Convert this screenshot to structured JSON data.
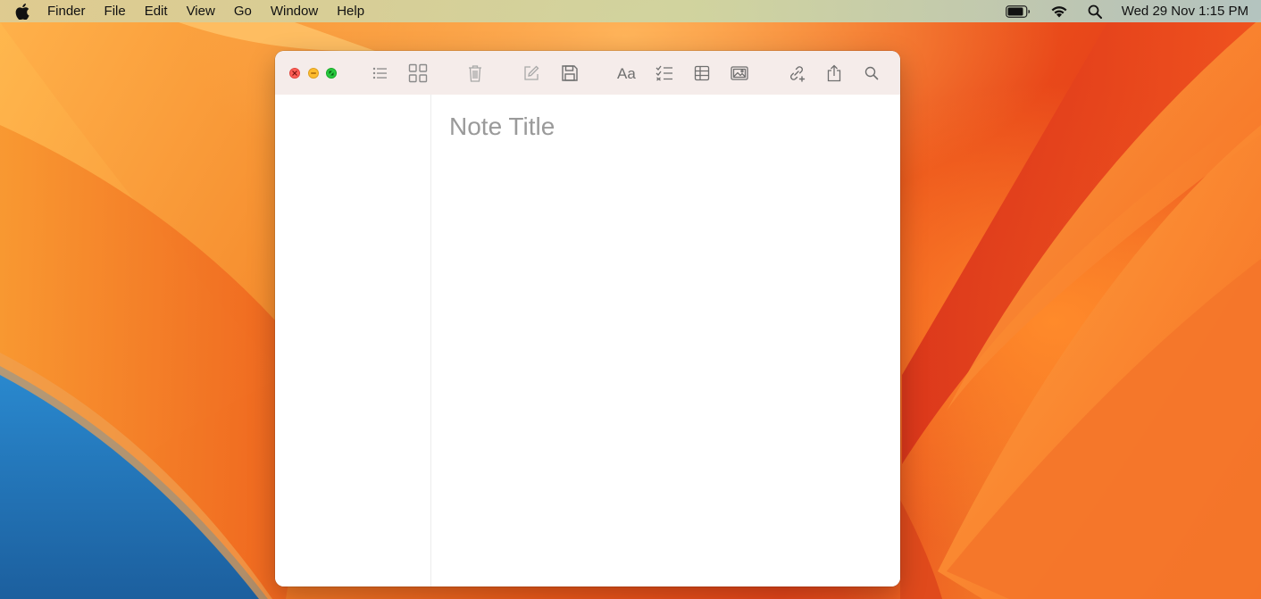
{
  "menubar": {
    "app_name": "Finder",
    "items": [
      "File",
      "Edit",
      "View",
      "Go",
      "Window",
      "Help"
    ],
    "clock": "Wed 29 Nov  1:15 PM"
  },
  "window": {
    "toolbar": {
      "buttons": [
        "list-view",
        "gallery-view",
        "delete",
        "compose",
        "save",
        "format-text",
        "checklist",
        "table",
        "media",
        "link",
        "share",
        "search"
      ]
    },
    "editor": {
      "title_placeholder": "Note Title"
    }
  },
  "colors": {
    "close": "#fe5f57",
    "minimize": "#febc2e",
    "maximize": "#28c840",
    "toolbar_bg": "#f5ecea",
    "icon": "#8a8a8a"
  }
}
